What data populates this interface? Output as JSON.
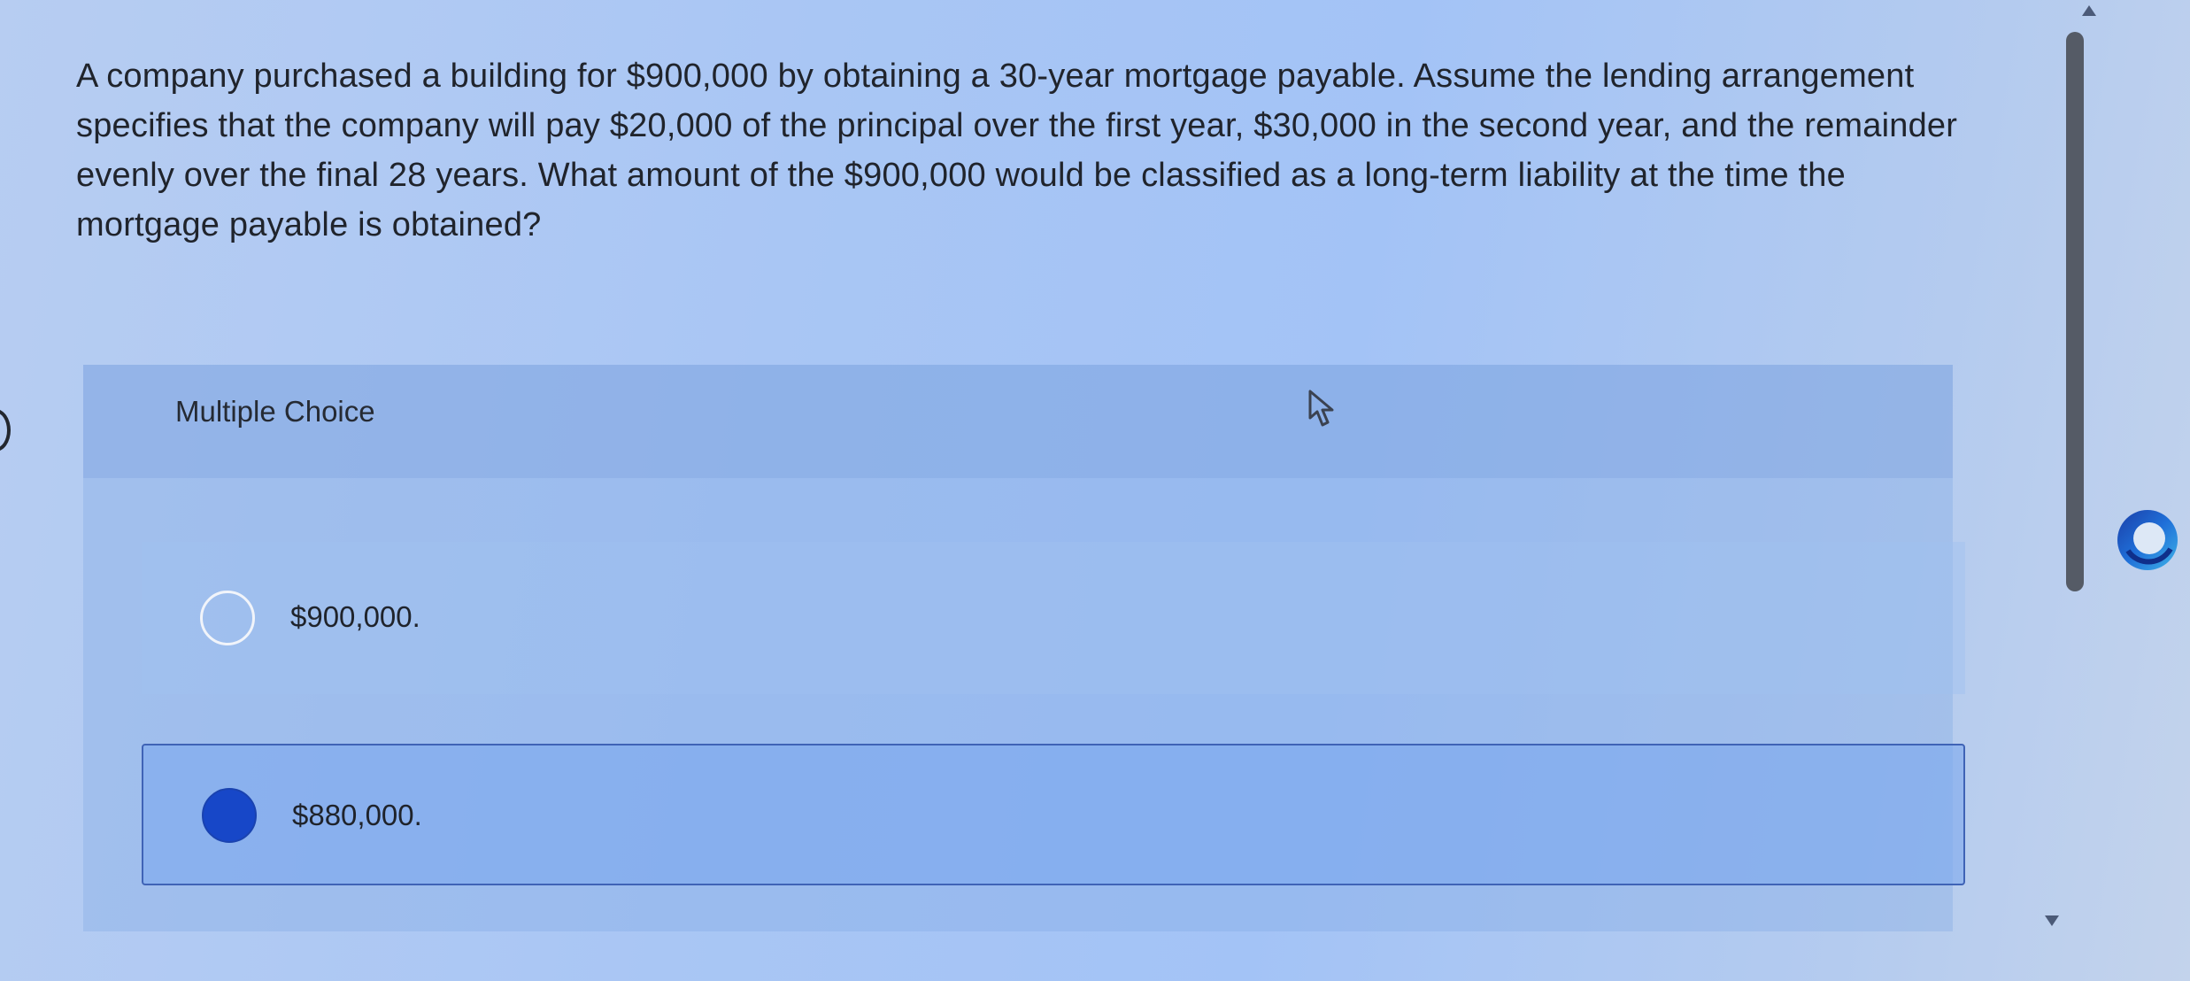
{
  "question": {
    "text": "A company purchased a building for $900,000 by obtaining a 30-year mortgage payable. Assume the lending arrangement specifies that the company will pay $20,000 of the principal over the first year, $30,000 in the second year, and the remainder evenly over the final 28 years. What amount of the $900,000 would be classified as a long-term liability at the time the mortgage payable is obtained?"
  },
  "multiple_choice": {
    "title": "Multiple Choice",
    "options": [
      {
        "label": "$900,000.",
        "selected": false
      },
      {
        "label": "$880,000.",
        "selected": true
      }
    ]
  },
  "colors": {
    "selected_radio": "#1747c8",
    "selected_border": "#3f63b6",
    "background": "#a9c6f4"
  },
  "icons": {
    "cursor": "pointer-cursor-icon",
    "logo": "circular-arrow-logo-icon"
  }
}
